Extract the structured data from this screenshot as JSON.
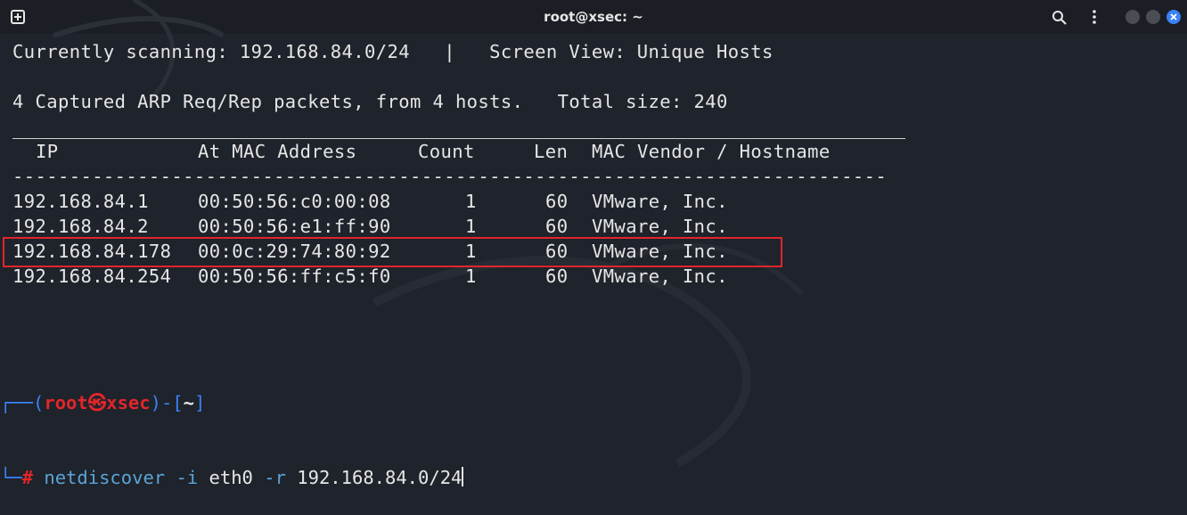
{
  "window": {
    "title": "root@xsec: ~"
  },
  "scan_line": "Currently scanning: 192.168.84.0/24   |   Screen View: Unique Hosts",
  "summary_line": "4 Captured ARP Req/Rep packets, from 4 hosts.   Total size: 240",
  "table": {
    "headers": {
      "ip": "IP",
      "mac": "At MAC Address",
      "count": "Count",
      "len": "Len",
      "vendor": "MAC Vendor / Hostname"
    },
    "separator": "-----------------------------------------------------------------------------",
    "rows": [
      {
        "ip": "192.168.84.1",
        "mac": "00:50:56:c0:00:08",
        "count": "1",
        "len": "60",
        "vendor": "VMware, Inc."
      },
      {
        "ip": "192.168.84.2",
        "mac": "00:50:56:e1:ff:90",
        "count": "1",
        "len": "60",
        "vendor": "VMware, Inc."
      },
      {
        "ip": "192.168.84.178",
        "mac": "00:0c:29:74:80:92",
        "count": "1",
        "len": "60",
        "vendor": "VMware, Inc."
      },
      {
        "ip": "192.168.84.254",
        "mac": "00:50:56:ff:c5:f0",
        "count": "1",
        "len": "60",
        "vendor": "VMware, Inc."
      }
    ],
    "highlighted_row": 2
  },
  "prompt": {
    "open": "┌──(",
    "user": "root",
    "at": "㉿",
    "host": "xsec",
    "close": ")-[",
    "dir": "~",
    "end": "]",
    "line2": "└─",
    "hash": "#",
    "command": "netdiscover",
    "flag_i": "-i",
    "iface": "eth0",
    "flag_r": "-r",
    "range": "192.168.84.0/24"
  },
  "colors": {
    "accent": "#3b82f6",
    "highlight_box": "#e0262b",
    "background": "#1f232b"
  }
}
